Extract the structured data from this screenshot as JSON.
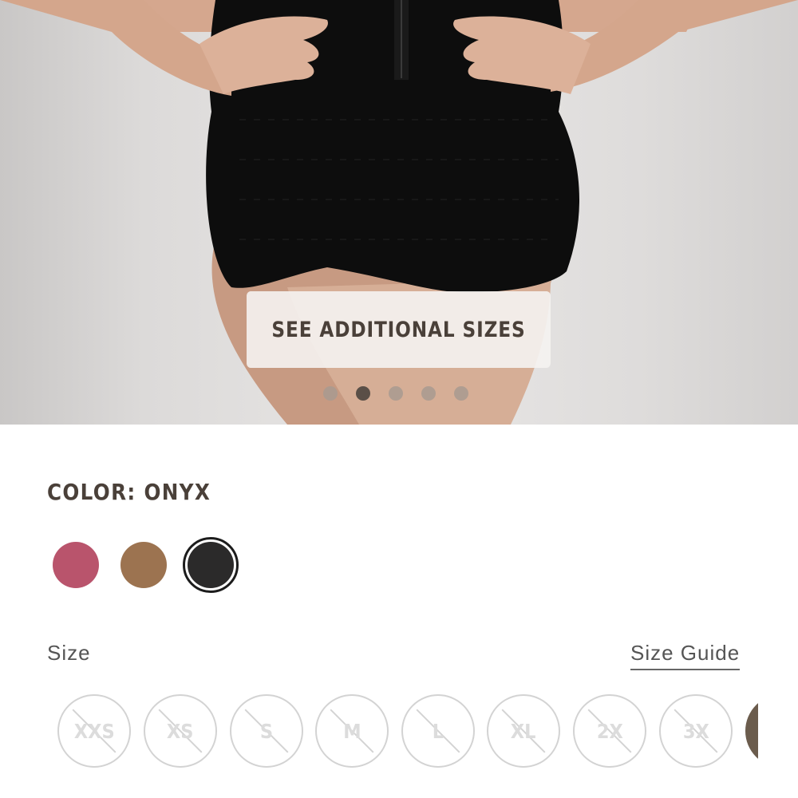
{
  "hero": {
    "see_sizes_label": "SEE ADDITIONAL SIZES",
    "carousel_total": 5,
    "carousel_active_index": 1
  },
  "color": {
    "label": "COLOR: ONYX",
    "swatches": [
      {
        "name": "rose",
        "hex": "#b9546c",
        "selected": false
      },
      {
        "name": "brown",
        "hex": "#9c7350",
        "selected": false
      },
      {
        "name": "onyx",
        "hex": "#2b2a2a",
        "selected": true
      }
    ]
  },
  "size": {
    "label": "Size",
    "guide_label": "Size Guide",
    "options": [
      {
        "label": "XXS",
        "available": false
      },
      {
        "label": "XS",
        "available": false
      },
      {
        "label": "S",
        "available": false
      },
      {
        "label": "M",
        "available": false
      },
      {
        "label": "L",
        "available": false
      },
      {
        "label": "XL",
        "available": false
      },
      {
        "label": "2X",
        "available": false
      },
      {
        "label": "3X",
        "available": false
      }
    ]
  },
  "colors": {
    "text_primary": "#4a4039",
    "text_secondary": "#555555",
    "unavailable": "#d3d3d3",
    "partial_size_fill": "#6b5c4d"
  }
}
